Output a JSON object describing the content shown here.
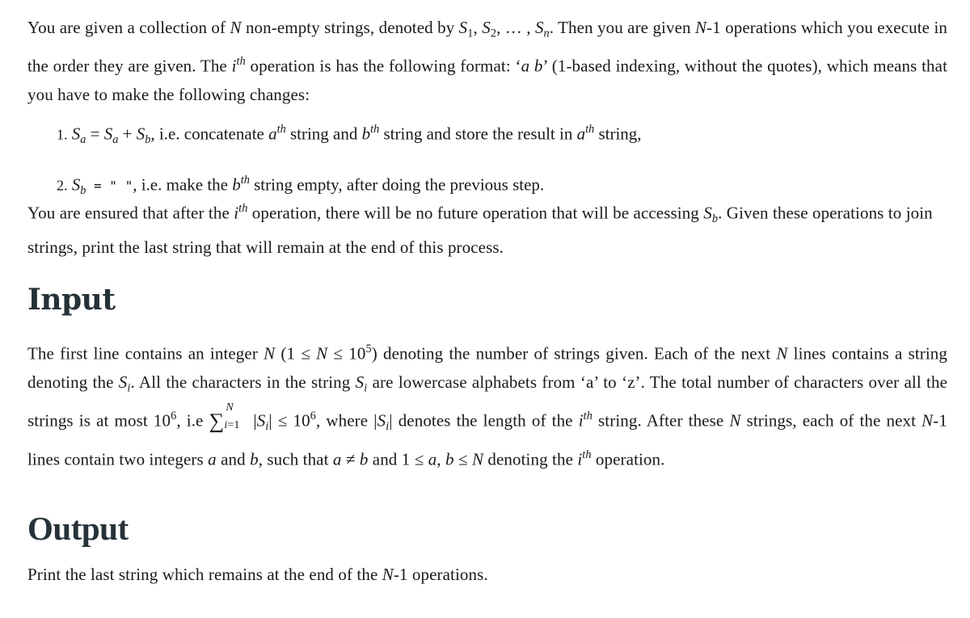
{
  "statement": {
    "p1": {
      "t1": "You are given a collection of ",
      "N": "N",
      "t2": " non-empty strings, denoted by ",
      "S": "S",
      "s1": "1",
      "s2": "2",
      "dots": "…",
      "sn": "n",
      "t3": ". Then you are given ",
      "nminus1": "-1",
      "t4": " operations which you execute in the order they are given. The ",
      "i": "i",
      "th": "th",
      "t5": " operation is has the following format: ",
      "lq": "‘",
      "a": "a",
      "b": "b",
      "rq": "’",
      "t6": " (1-based indexing, without the quotes), which means that you have to make the following changes:"
    },
    "list": [
      {
        "num": "1.",
        "eq": " = ",
        "plus": " + ",
        "text1": ", i.e. concatenate ",
        "text2": " string and ",
        "text3": " string and store the result in ",
        "text4": " string,"
      },
      {
        "num": "2.",
        "eq": " = ",
        "empty": "\" \"",
        "text1": ", i.e. make the ",
        "text2": " string empty, after doing the previous step."
      }
    ],
    "p2": {
      "t1": "You are ensured that after the ",
      "t2": " operation, there will be no future operation that will be accessing ",
      "t3": ". Given these operations to join strings, print the last string that will remain at the end of this process."
    }
  },
  "input": {
    "heading": "Input",
    "t1": "The first line contains an integer ",
    "range_open": " (1 ≤ ",
    "range_mid": " ≤ 10",
    "exp5": "5",
    "range_close": ")",
    "t2": " denoting the number of strings given. Each of the next ",
    "t3": " lines contains a string denoting the ",
    "t4": ". All the characters in the string ",
    "t5": " are lowercase alphabets from ‘a’ to ‘z’. The total number of characters over all the strings is at most 10",
    "exp6": "6",
    "t6": ", i.e ",
    "sum": "∑",
    "sum_top": "N",
    "sum_bot": "i=1",
    "abs_l": "|",
    "abs_r": "|",
    "le": " ≤ 10",
    "t7": ", where ",
    "t8": " denotes the length of the ",
    "t9": " string. After these ",
    "t10": " strings, each of the next ",
    "t11": " lines contain two integers ",
    "and": " and ",
    "t12": ", such that ",
    "neq": " ≠ ",
    "t13": " and 1 ≤ ",
    "comma": ", ",
    "t14": " ≤ ",
    "t15": " denoting the ",
    "t16": " operation."
  },
  "output": {
    "heading": "Output",
    "t1": "Print the last string which remains at the end of the ",
    "t2": " operations."
  }
}
